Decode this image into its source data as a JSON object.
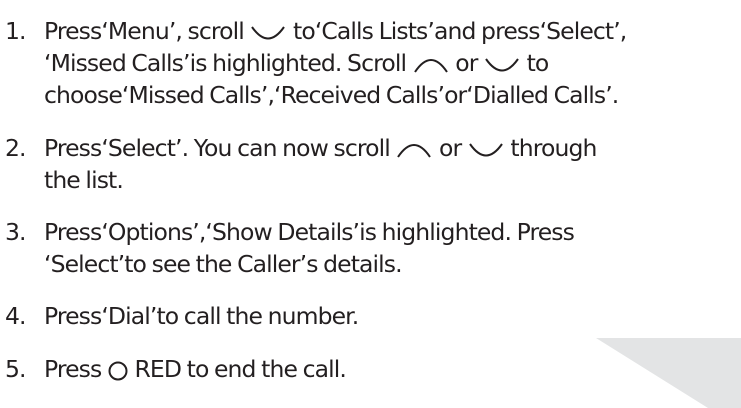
{
  "steps": [
    {
      "number": "1.",
      "lines": [
        [
          "Press‘Menu’, scroll ",
          "scroll-down-icon",
          " to‘Calls Lists’and press‘Select’,"
        ],
        [
          "‘Missed Calls’is highlighted.  Scroll ",
          "scroll-up-icon",
          " or ",
          "scroll-down-icon",
          " to"
        ],
        [
          "choose‘Missed Calls’,‘Received Calls’or‘Dialled Calls’."
        ]
      ]
    },
    {
      "number": "2.",
      "lines": [
        [
          "Press‘Select’.  You can now scroll ",
          "scroll-up-icon",
          " or ",
          "scroll-down-icon",
          " through"
        ],
        [
          "the list."
        ]
      ]
    },
    {
      "number": "3.",
      "lines": [
        [
          "Press‘Options’,‘Show Details’is highlighted.  Press"
        ],
        [
          "‘Select’to see the Caller’s details."
        ]
      ]
    },
    {
      "number": "4.",
      "lines": [
        [
          "Press‘Dial’to call the number."
        ]
      ]
    },
    {
      "number": "5.",
      "lines": [
        [
          "Press ",
          "end-call-icon",
          " RED to end the call."
        ]
      ]
    }
  ],
  "colors": {
    "text": "#231f20",
    "decor": "#e3e4e5"
  }
}
